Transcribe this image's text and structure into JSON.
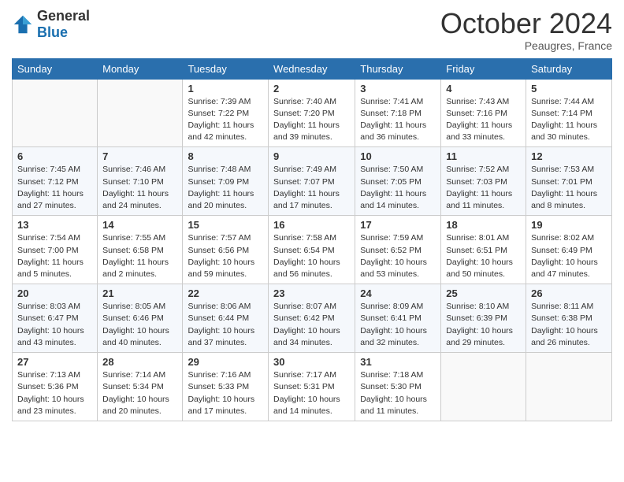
{
  "header": {
    "logo_general": "General",
    "logo_blue": "Blue",
    "month": "October 2024",
    "location": "Peaugres, France"
  },
  "weekdays": [
    "Sunday",
    "Monday",
    "Tuesday",
    "Wednesday",
    "Thursday",
    "Friday",
    "Saturday"
  ],
  "weeks": [
    [
      {
        "day": "",
        "info": ""
      },
      {
        "day": "",
        "info": ""
      },
      {
        "day": "1",
        "info": "Sunrise: 7:39 AM\nSunset: 7:22 PM\nDaylight: 11 hours and 42 minutes."
      },
      {
        "day": "2",
        "info": "Sunrise: 7:40 AM\nSunset: 7:20 PM\nDaylight: 11 hours and 39 minutes."
      },
      {
        "day": "3",
        "info": "Sunrise: 7:41 AM\nSunset: 7:18 PM\nDaylight: 11 hours and 36 minutes."
      },
      {
        "day": "4",
        "info": "Sunrise: 7:43 AM\nSunset: 7:16 PM\nDaylight: 11 hours and 33 minutes."
      },
      {
        "day": "5",
        "info": "Sunrise: 7:44 AM\nSunset: 7:14 PM\nDaylight: 11 hours and 30 minutes."
      }
    ],
    [
      {
        "day": "6",
        "info": "Sunrise: 7:45 AM\nSunset: 7:12 PM\nDaylight: 11 hours and 27 minutes."
      },
      {
        "day": "7",
        "info": "Sunrise: 7:46 AM\nSunset: 7:10 PM\nDaylight: 11 hours and 24 minutes."
      },
      {
        "day": "8",
        "info": "Sunrise: 7:48 AM\nSunset: 7:09 PM\nDaylight: 11 hours and 20 minutes."
      },
      {
        "day": "9",
        "info": "Sunrise: 7:49 AM\nSunset: 7:07 PM\nDaylight: 11 hours and 17 minutes."
      },
      {
        "day": "10",
        "info": "Sunrise: 7:50 AM\nSunset: 7:05 PM\nDaylight: 11 hours and 14 minutes."
      },
      {
        "day": "11",
        "info": "Sunrise: 7:52 AM\nSunset: 7:03 PM\nDaylight: 11 hours and 11 minutes."
      },
      {
        "day": "12",
        "info": "Sunrise: 7:53 AM\nSunset: 7:01 PM\nDaylight: 11 hours and 8 minutes."
      }
    ],
    [
      {
        "day": "13",
        "info": "Sunrise: 7:54 AM\nSunset: 7:00 PM\nDaylight: 11 hours and 5 minutes."
      },
      {
        "day": "14",
        "info": "Sunrise: 7:55 AM\nSunset: 6:58 PM\nDaylight: 11 hours and 2 minutes."
      },
      {
        "day": "15",
        "info": "Sunrise: 7:57 AM\nSunset: 6:56 PM\nDaylight: 10 hours and 59 minutes."
      },
      {
        "day": "16",
        "info": "Sunrise: 7:58 AM\nSunset: 6:54 PM\nDaylight: 10 hours and 56 minutes."
      },
      {
        "day": "17",
        "info": "Sunrise: 7:59 AM\nSunset: 6:52 PM\nDaylight: 10 hours and 53 minutes."
      },
      {
        "day": "18",
        "info": "Sunrise: 8:01 AM\nSunset: 6:51 PM\nDaylight: 10 hours and 50 minutes."
      },
      {
        "day": "19",
        "info": "Sunrise: 8:02 AM\nSunset: 6:49 PM\nDaylight: 10 hours and 47 minutes."
      }
    ],
    [
      {
        "day": "20",
        "info": "Sunrise: 8:03 AM\nSunset: 6:47 PM\nDaylight: 10 hours and 43 minutes."
      },
      {
        "day": "21",
        "info": "Sunrise: 8:05 AM\nSunset: 6:46 PM\nDaylight: 10 hours and 40 minutes."
      },
      {
        "day": "22",
        "info": "Sunrise: 8:06 AM\nSunset: 6:44 PM\nDaylight: 10 hours and 37 minutes."
      },
      {
        "day": "23",
        "info": "Sunrise: 8:07 AM\nSunset: 6:42 PM\nDaylight: 10 hours and 34 minutes."
      },
      {
        "day": "24",
        "info": "Sunrise: 8:09 AM\nSunset: 6:41 PM\nDaylight: 10 hours and 32 minutes."
      },
      {
        "day": "25",
        "info": "Sunrise: 8:10 AM\nSunset: 6:39 PM\nDaylight: 10 hours and 29 minutes."
      },
      {
        "day": "26",
        "info": "Sunrise: 8:11 AM\nSunset: 6:38 PM\nDaylight: 10 hours and 26 minutes."
      }
    ],
    [
      {
        "day": "27",
        "info": "Sunrise: 7:13 AM\nSunset: 5:36 PM\nDaylight: 10 hours and 23 minutes."
      },
      {
        "day": "28",
        "info": "Sunrise: 7:14 AM\nSunset: 5:34 PM\nDaylight: 10 hours and 20 minutes."
      },
      {
        "day": "29",
        "info": "Sunrise: 7:16 AM\nSunset: 5:33 PM\nDaylight: 10 hours and 17 minutes."
      },
      {
        "day": "30",
        "info": "Sunrise: 7:17 AM\nSunset: 5:31 PM\nDaylight: 10 hours and 14 minutes."
      },
      {
        "day": "31",
        "info": "Sunrise: 7:18 AM\nSunset: 5:30 PM\nDaylight: 10 hours and 11 minutes."
      },
      {
        "day": "",
        "info": ""
      },
      {
        "day": "",
        "info": ""
      }
    ]
  ]
}
